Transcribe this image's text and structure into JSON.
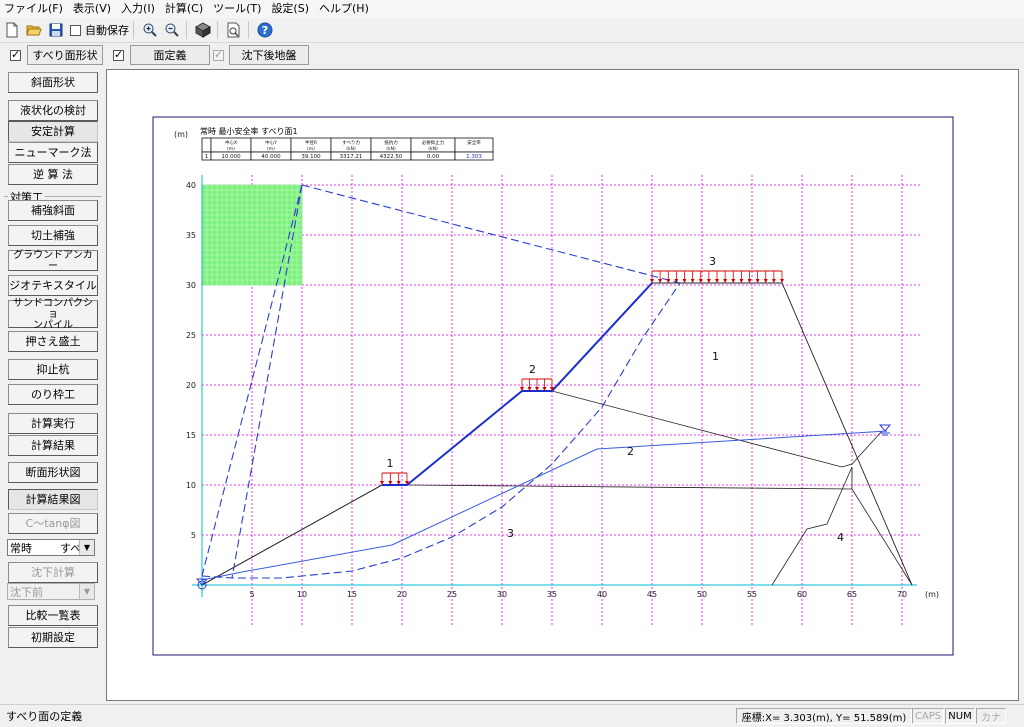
{
  "menubar": {
    "items": [
      "ファイル(F)",
      "表示(V)",
      "入力(I)",
      "計算(C)",
      "ツール(T)",
      "設定(S)",
      "ヘルプ(H)"
    ]
  },
  "toolbar": {
    "icons": [
      "new-file-icon",
      "open-folder-icon",
      "save-icon",
      "zoom-in-icon",
      "zoom-out-icon",
      "cube-icon",
      "print-preview-icon",
      "help-icon"
    ],
    "autosave_label": "自動保存",
    "autosave_checked": false
  },
  "toolbar2": {
    "slip_shape_checked": true,
    "slip_shape_label": "すべり面形状",
    "surface_def_checked": true,
    "surface_def_label": "面定義",
    "settled_ground_checked": true,
    "settled_ground_label": "沈下後地盤"
  },
  "leftpanel": {
    "slope_shape": "斜面形状",
    "liquefaction": "液状化の検討",
    "stability": "安定計算",
    "newmark": "ニューマーク法",
    "back_calc": "逆 算 法",
    "group_label": "対策工",
    "reinforced_slope": "補強斜面",
    "cut_reinforcement": "切土補強",
    "ground_anchor": "グラウンドアンカー",
    "geotextile": "ジオテキスタイル",
    "sand_compaction_1": "サンドコンパクショ",
    "sand_compaction_2": "ンパイル",
    "counterweight": "押さえ盛土",
    "restraint_pile": "抑止杭",
    "frame_work": "のり枠工",
    "run_calc": "計算実行",
    "calc_result": "計算結果",
    "section_diagram": "断面形状図",
    "result_diagram": "計算結果図",
    "c_tan_diagram": "C〜tanφ図",
    "condition_value": "常時",
    "surface_value": "すべ",
    "settlement_calc": "沈下計算",
    "settlement_value": "沈下前",
    "comparison": "比較一覧表",
    "initial_settings": "初期設定"
  },
  "statusbar": {
    "message": "すべり面の定義",
    "coords": "座標:X=   3.303(m), Y=  51.589(m)",
    "caps": "CAPS",
    "num": "NUM",
    "kana": "カナ"
  },
  "chart_data": {
    "type": "line",
    "title": "常時 最小安全率 すべり面1",
    "xlabel": "(m)",
    "ylabel": "(m)",
    "xlim": [
      0,
      72
    ],
    "ylim": [
      0,
      41
    ],
    "grid": true,
    "x_ticks": [
      5,
      10,
      15,
      20,
      25,
      30,
      35,
      40,
      45,
      50,
      55,
      60,
      65,
      70
    ],
    "y_ticks": [
      5,
      10,
      15,
      20,
      25,
      30,
      35,
      40
    ],
    "table": {
      "headers": [
        "",
        "中心X\n(m)",
        "中心Y\n(m)",
        "半径R\n(m)",
        "すべり力\n(kN)",
        "抵抗力\n(kN)",
        "必要抑止力\n(kN)",
        "安全率"
      ],
      "row": [
        "1",
        "10.000",
        "40.000",
        "39.100",
        "3317.21",
        "4322.50",
        "0.00",
        "1.303"
      ]
    },
    "ground_surface": {
      "x": [
        0,
        18,
        20.5,
        32,
        35,
        45,
        58,
        71
      ],
      "y": [
        0,
        10,
        10,
        19.4,
        19.4,
        30.2,
        30.2,
        0
      ]
    },
    "layer_boundaries": [
      {
        "x": [
          0,
          18,
          20.5,
          65,
          71
        ],
        "y": [
          0,
          10,
          10,
          9.6,
          0
        ]
      },
      {
        "x": [
          35,
          64,
          65,
          68
        ],
        "y": [
          19.4,
          11.8,
          12.1,
          15.4
        ]
      },
      {
        "x": [
          57,
          60.5,
          62.5,
          65,
          65
        ],
        "y": [
          0,
          5.6,
          6.1,
          11.8,
          9.6
        ]
      }
    ],
    "water_table": {
      "x": [
        0,
        4,
        19,
        39.5,
        68.5
      ],
      "y": [
        0.5,
        1.3,
        4,
        13.6,
        15.4
      ]
    },
    "slip_circle": {
      "center": [
        10,
        40
      ],
      "radius": 39.1,
      "x": [
        0,
        3,
        8,
        15,
        20,
        25,
        30,
        35,
        40,
        44,
        47.8
      ],
      "y": [
        0.9,
        0.7,
        0.7,
        1.4,
        2.7,
        4.8,
        7.8,
        12.1,
        17.8,
        24.6,
        30.2
      ]
    },
    "search_grid": {
      "x": [
        0,
        10
      ],
      "y": [
        30,
        40
      ]
    },
    "loads": [
      {
        "label": "1",
        "x": [
          18,
          20.5
        ],
        "y": 10
      },
      {
        "label": "2",
        "x": [
          32,
          35
        ],
        "y": 19.4
      },
      {
        "label": "3",
        "x": [
          45,
          58
        ],
        "y": 30.2
      }
    ],
    "soil_labels": [
      {
        "label": "1",
        "x": 51,
        "y": 22.5
      },
      {
        "label": "2",
        "x": 42.5,
        "y": 13
      },
      {
        "label": "3",
        "x": 30.5,
        "y": 4.8
      },
      {
        "label": "4",
        "x": 63.5,
        "y": 4.4
      }
    ]
  }
}
